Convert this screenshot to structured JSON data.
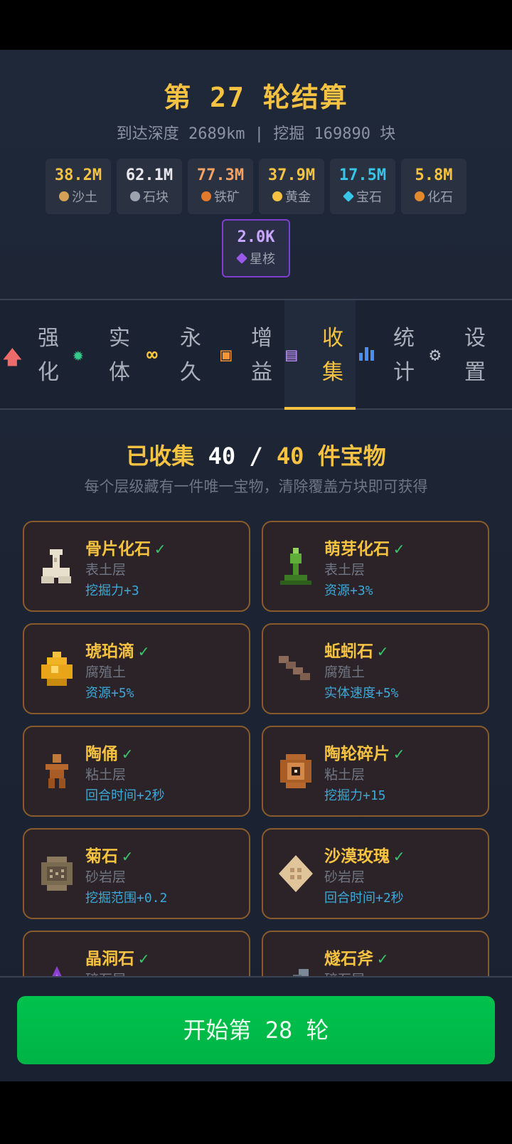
{
  "header": {
    "title": "第 27 轮结算",
    "subtitle": "到达深度 2689km | 挖掘 169890 块"
  },
  "resources": [
    {
      "value": "38.2M",
      "label": "沙土",
      "color": "#f5c242",
      "icon": "sand-icon",
      "icon_color": "#d4a055"
    },
    {
      "value": "62.1M",
      "label": "石块",
      "color": "#e8e8ec",
      "icon": "stone-icon",
      "icon_color": "#9ea4ad"
    },
    {
      "value": "77.3M",
      "label": "铁矿",
      "color": "#f5a263",
      "icon": "iron-ore-icon",
      "icon_color": "#e07a2c"
    },
    {
      "value": "37.9M",
      "label": "黄金",
      "color": "#f5c242",
      "icon": "gold-icon",
      "icon_color": "#f5c242"
    },
    {
      "value": "17.5M",
      "label": "宝石",
      "color": "#38c6e8",
      "icon": "gem-icon",
      "icon_color": "#38c6e8"
    },
    {
      "value": "5.8M",
      "label": "化石",
      "color": "#f5c242",
      "icon": "fossil-icon",
      "icon_color": "#e08a2a"
    }
  ],
  "core": {
    "value": "2.0K",
    "label": "星核",
    "color": "#c9a6ff",
    "icon": "star-core-icon",
    "icon_color": "#9b59e8"
  },
  "tabs": [
    {
      "label": "强化",
      "icon": "upgrade-arrow-icon",
      "icon_char": "🡅",
      "icon_color": "#ef6a6a",
      "active": false
    },
    {
      "label": "实体",
      "icon": "entity-gear-icon",
      "icon_char": "✹",
      "icon_color": "#36c98a",
      "active": false
    },
    {
      "label": "永久",
      "icon": "infinity-icon",
      "icon_char": "∞",
      "icon_color": "#f5c242",
      "active": false
    },
    {
      "label": "增益",
      "icon": "buff-chest-icon",
      "icon_char": "▣",
      "icon_color": "#f0953a",
      "active": false
    },
    {
      "label": "收集",
      "icon": "collection-list-icon",
      "icon_char": "▤",
      "icon_color": "#b98af0",
      "active": true
    },
    {
      "label": "统计",
      "icon": "stats-chart-icon",
      "icon_char": "▮",
      "icon_color": "#4a8ff0",
      "active": false
    },
    {
      "label": "设置",
      "icon": "settings-gear-icon",
      "icon_char": "⚙",
      "icon_color": "#b8bec8",
      "active": false
    }
  ],
  "collection": {
    "title_prefix": "已收集",
    "collected": "40",
    "separator": "/",
    "total": "40",
    "title_suffix": "件宝物",
    "description": "每个层级藏有一件唯一宝物，清除覆盖方块即可获得",
    "items": [
      {
        "name": "骨片化石",
        "layer": "表土层",
        "bonus": "挖掘力+3",
        "icon": "bone-fossil-icon",
        "color": "#e8e0cc"
      },
      {
        "name": "萌芽化石",
        "layer": "表土层",
        "bonus": "资源+3%",
        "icon": "sprout-fossil-icon",
        "color": "#5fae3a"
      },
      {
        "name": "琥珀滴",
        "layer": "腐殖土",
        "bonus": "资源+5%",
        "icon": "amber-drop-icon",
        "color": "#f0b323"
      },
      {
        "name": "蚯蚓石",
        "layer": "腐殖土",
        "bonus": "实体速度+5%",
        "icon": "worm-stone-icon",
        "color": "#8b6a5a"
      },
      {
        "name": "陶俑",
        "layer": "粘土层",
        "bonus": "回合时间+2秒",
        "icon": "terracotta-figure-icon",
        "color": "#b5672e"
      },
      {
        "name": "陶轮碎片",
        "layer": "粘土层",
        "bonus": "挖掘力+15",
        "icon": "pottery-wheel-shard-icon",
        "color": "#b5672e"
      },
      {
        "name": "菊石",
        "layer": "砂岩层",
        "bonus": "挖掘范围+0.2",
        "icon": "ammonite-icon",
        "color": "#8b7a5e"
      },
      {
        "name": "沙漠玫瑰",
        "layer": "砂岩层",
        "bonus": "回合时间+2秒",
        "icon": "desert-rose-icon",
        "color": "#e0c59a"
      },
      {
        "name": "晶洞石",
        "layer": "碎石层",
        "bonus": "",
        "icon": "geode-icon",
        "color": "#8a3fd0"
      },
      {
        "name": "燧石斧",
        "layer": "碎石层",
        "bonus": "",
        "icon": "flint-axe-icon",
        "color": "#7a8898"
      }
    ],
    "check": "✓"
  },
  "start_button": {
    "label": "开始第 28 轮"
  }
}
